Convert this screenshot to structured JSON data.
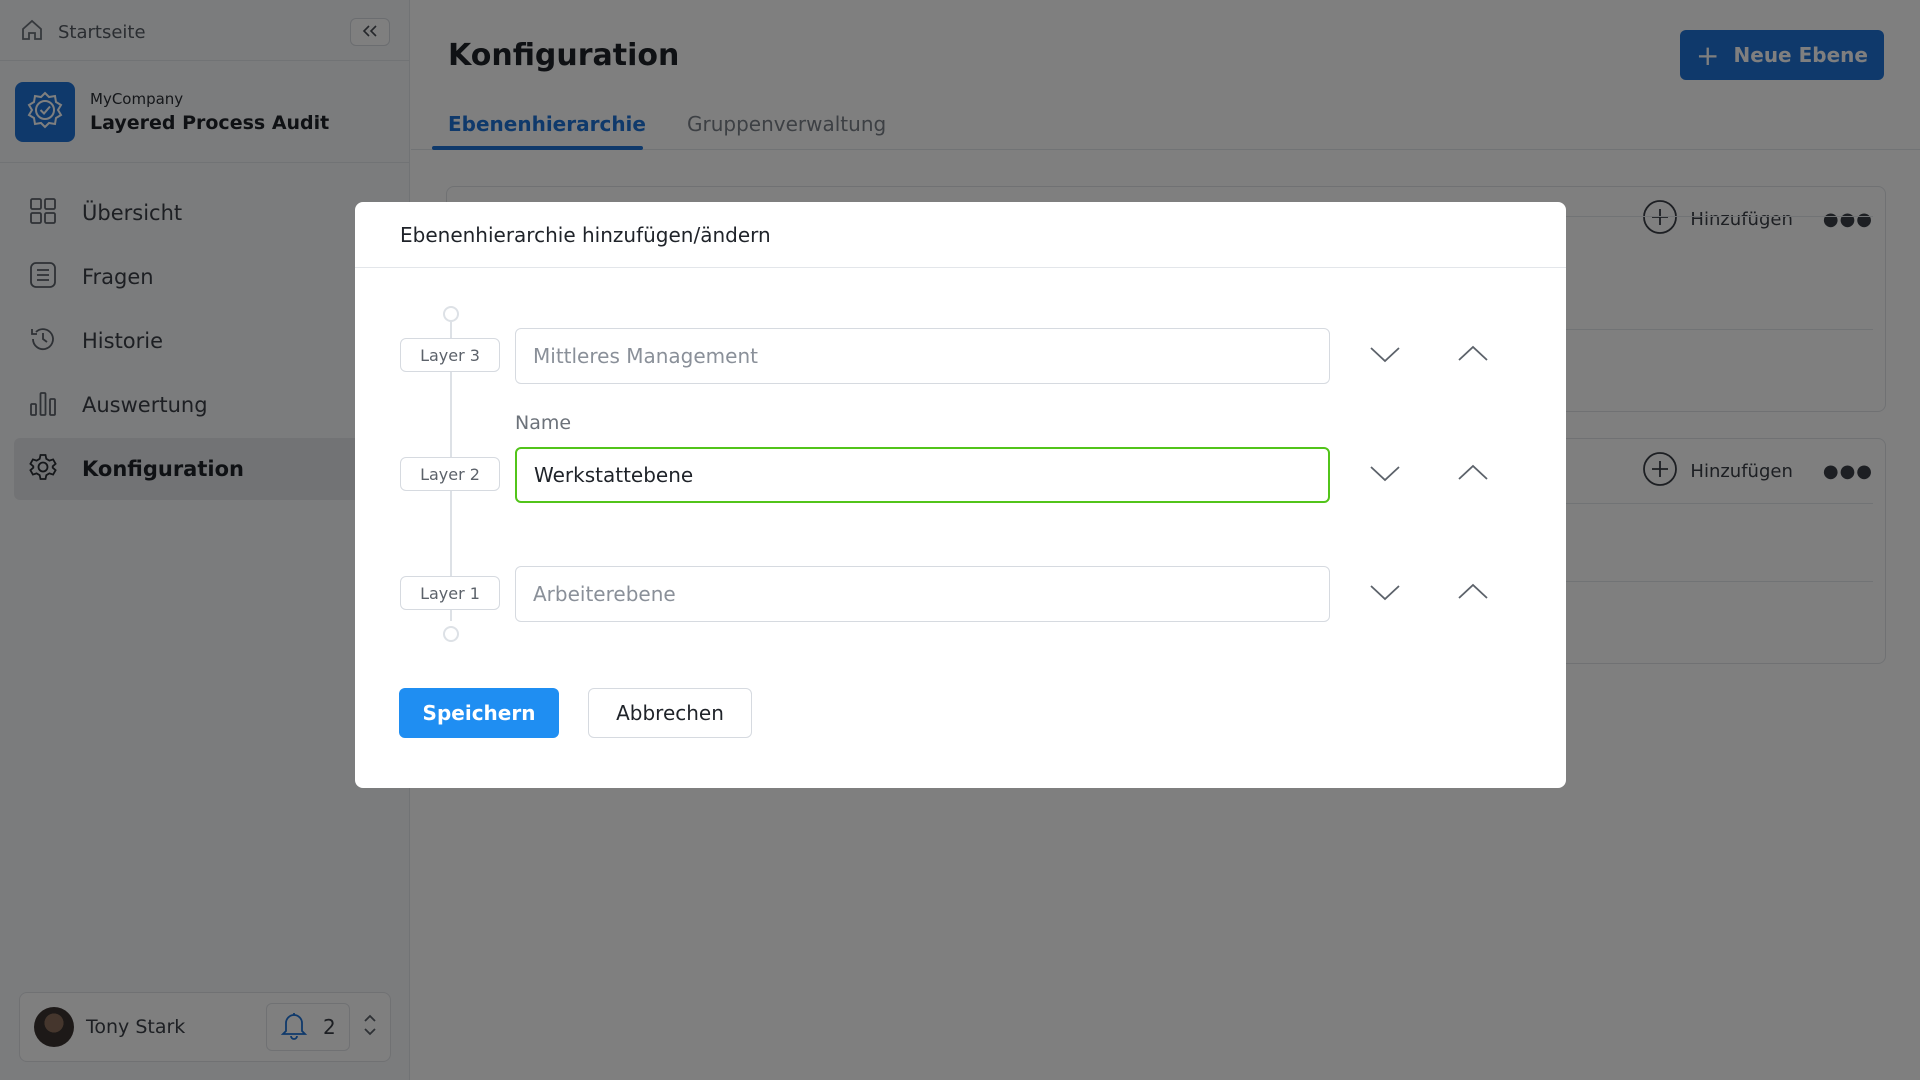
{
  "sidebar": {
    "home_label": "Startseite",
    "company": "MyCompany",
    "app_name": "Layered Process Audit",
    "nav_items": [
      {
        "label": "Übersicht",
        "icon": "grid-icon"
      },
      {
        "label": "Fragen",
        "icon": "list-icon"
      },
      {
        "label": "Historie",
        "icon": "history-icon"
      },
      {
        "label": "Auswertung",
        "icon": "bar-chart-icon"
      },
      {
        "label": "Konfiguration",
        "icon": "gear-icon",
        "active": true
      }
    ],
    "user": {
      "name": "Tony Stark",
      "notification_count": "2"
    }
  },
  "main": {
    "title": "Konfiguration",
    "new_button_label": "Neue Ebene",
    "tabs": [
      {
        "label": "Ebenenhierarchie",
        "active": true
      },
      {
        "label": "Gruppenverwaltung",
        "active": false
      }
    ],
    "card_action_label": "Hinzufügen"
  },
  "modal": {
    "title": "Ebenenhierarchie hinzufügen/ändern",
    "field_label": "Name",
    "layers": [
      {
        "tag": "Layer 3",
        "value": "",
        "placeholder": "Mittleres Management"
      },
      {
        "tag": "Layer 2",
        "value": "Werkstattebene",
        "placeholder": ""
      },
      {
        "tag": "Layer 1",
        "value": "",
        "placeholder": "Arbeiterebene"
      }
    ],
    "save_label": "Speichern",
    "cancel_label": "Abbrechen"
  },
  "colors": {
    "accent": "#1f73d6",
    "primary_button": "#1f8ef2",
    "focus_border": "#52c41a",
    "overlay": "rgba(0,0,0,0.5)"
  }
}
